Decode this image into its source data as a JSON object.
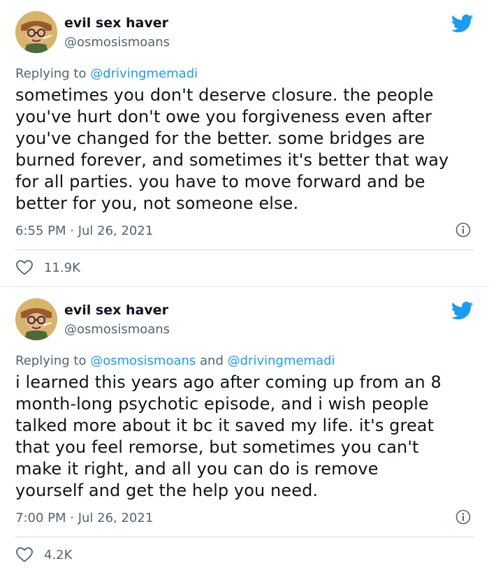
{
  "tweets": [
    {
      "display_name": "evil sex haver",
      "handle": "@osmosismoans",
      "replying_prefix": "Replying to",
      "replying_mentions": [
        "@drivingmemadi"
      ],
      "replying_joiner": "",
      "lines": [
        "sometimes you don't deserve closure. the people",
        "you've hurt don't owe you forgiveness even after",
        "you've changed for the better. some bridges are",
        "burned forever, and sometimes it's better that way",
        "for all parties. you have to move forward and be",
        "better for you, not someone else."
      ],
      "timestamp": "6:55 PM · Jul 26, 2021",
      "likes": "11.9K"
    },
    {
      "display_name": "evil sex haver",
      "handle": "@osmosismoans",
      "replying_prefix": "Replying to",
      "replying_mentions": [
        "@osmosismoans",
        "@drivingmemadi"
      ],
      "replying_joiner": "and",
      "lines": [
        "i learned this years ago after coming up from an 8",
        "month-long psychotic episode, and i wish people",
        "talked more about it bc it saved my life. it's great",
        "that you feel remorse, but sometimes you can't",
        "make it right, and all you can do is remove",
        "yourself and get the help you need."
      ],
      "timestamp": "7:00 PM · Jul 26, 2021",
      "likes": "4.2K"
    }
  ],
  "icons": {
    "brand": "twitter-bird-icon",
    "info": "info-icon",
    "like": "heart-icon"
  },
  "colors": {
    "twitter_blue": "#1d9bf0",
    "secondary_text": "#536471",
    "primary_text": "#0f1419",
    "divider": "#cfd9de"
  }
}
